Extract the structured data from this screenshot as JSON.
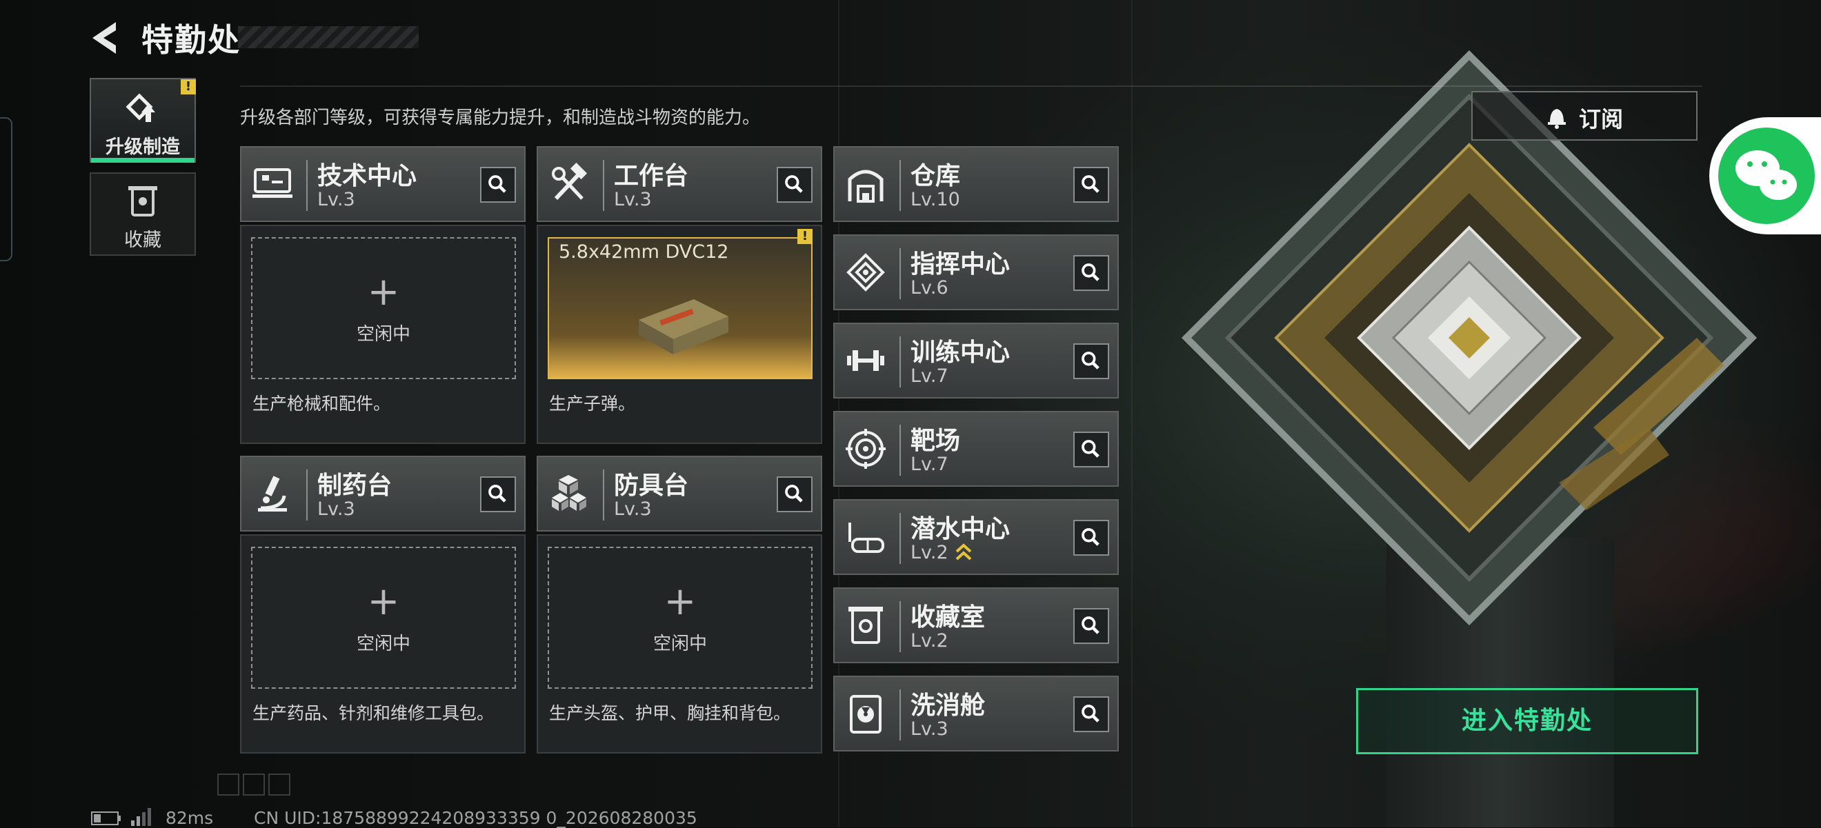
{
  "header": {
    "title": "特勤处"
  },
  "tabs": [
    {
      "label": "升级制造",
      "active": true,
      "badge": "!"
    },
    {
      "label": "收藏",
      "active": false
    }
  ],
  "description": "升级各部门等级，可获得专属能力提升，和制造战斗物资的能力。",
  "workstations": [
    {
      "name": "技术中心",
      "level": "Lv.3",
      "icon": "computer-icon",
      "status": "空闲中",
      "desc": "生产枪械和配件。"
    },
    {
      "name": "工作台",
      "level": "Lv.3",
      "icon": "hammer-wrench-icon",
      "product": "5.8x42mm DVC12",
      "product_badge": "!",
      "desc": "生产子弹。"
    },
    {
      "name": "制药台",
      "level": "Lv.3",
      "icon": "microscope-icon",
      "status": "空闲中",
      "desc": "生产药品、针剂和维修工具包。"
    },
    {
      "name": "防具台",
      "level": "Lv.3",
      "icon": "cubes-icon",
      "status": "空闲中",
      "desc": "生产头盔、护甲、胸挂和背包。"
    }
  ],
  "departments": [
    {
      "name": "仓库",
      "level": "Lv.10",
      "icon": "warehouse-icon"
    },
    {
      "name": "指挥中心",
      "level": "Lv.6",
      "icon": "chip-icon"
    },
    {
      "name": "训练中心",
      "level": "Lv.7",
      "icon": "dumbbell-icon"
    },
    {
      "name": "靶场",
      "level": "Lv.7",
      "icon": "target-icon"
    },
    {
      "name": "潜水中心",
      "level": "Lv.2",
      "icon": "diving-mask-icon",
      "upgrade": true
    },
    {
      "name": "收藏室",
      "level": "Lv.2",
      "icon": "collection-icon"
    },
    {
      "name": "洗消舱",
      "level": "Lv.3",
      "icon": "radiation-icon"
    }
  ],
  "subscribe_label": "订阅",
  "enter_label": "进入特勤处",
  "footer": {
    "ping": "82ms",
    "uid": "CN UID:18758899224208933359 0_202608280035"
  },
  "colors": {
    "accent": "#2ed58b",
    "warning": "#e6c43a",
    "product": "#e3b24a"
  }
}
